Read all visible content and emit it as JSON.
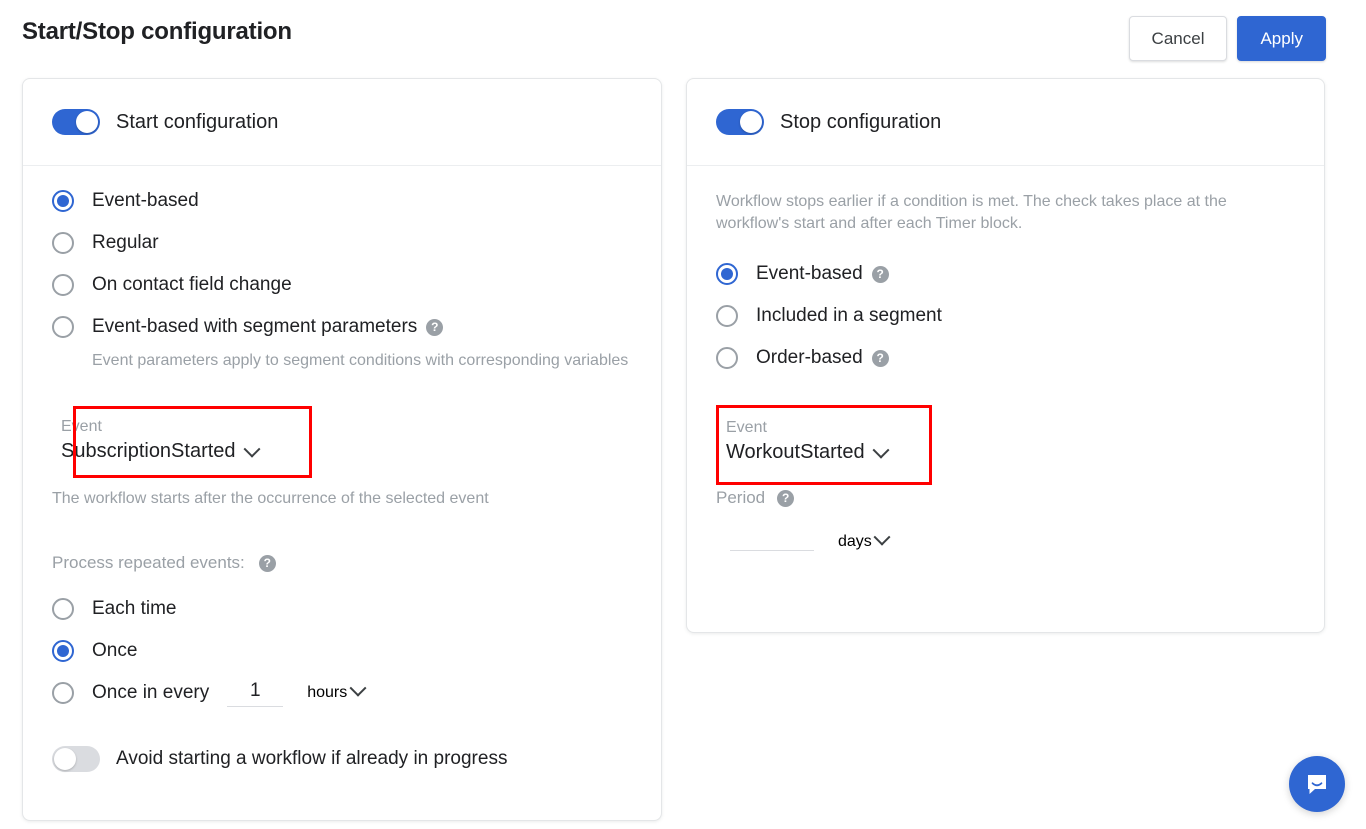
{
  "header": {
    "title": "Start/Stop configuration",
    "cancel_label": "Cancel",
    "apply_label": "Apply"
  },
  "colors": {
    "accent": "#2f66d2",
    "highlight": "#ff0000",
    "muted_text": "#9aa0a6",
    "text": "#202124",
    "border": "#e4e6e8"
  },
  "start_card": {
    "toggle_label": "Start configuration",
    "toggle_state": "on",
    "trigger_options": [
      {
        "label": "Event-based",
        "checked": true,
        "has_help": false
      },
      {
        "label": "Regular",
        "checked": false,
        "has_help": false
      },
      {
        "label": "On contact field change",
        "checked": false,
        "has_help": false
      },
      {
        "label": "Event-based with segment parameters",
        "checked": false,
        "has_help": true
      }
    ],
    "segment_params_hint": "Event parameters apply to segment conditions with corresponding variables",
    "event_field": {
      "label": "Event",
      "value": "SubscriptionStarted",
      "highlighted": true
    },
    "event_hint": "The workflow starts after the occurrence of the selected event",
    "repeat_section_label": "Process repeated events:",
    "repeat_options": [
      {
        "label": "Each time",
        "checked": false
      },
      {
        "label": "Once",
        "checked": true
      },
      {
        "label": "Once in every",
        "checked": false
      }
    ],
    "interval_value": "1",
    "interval_unit": "hours",
    "avoid_toggle_label": "Avoid starting a workflow if already in progress",
    "avoid_toggle_state": "off"
  },
  "stop_card": {
    "toggle_label": "Stop configuration",
    "toggle_state": "on",
    "description": "Workflow stops earlier if a condition is met. The check takes place at the workflow's start and after each Timer block.",
    "stop_options": [
      {
        "label": "Event-based",
        "checked": true,
        "has_help": true
      },
      {
        "label": "Included in a segment",
        "checked": false,
        "has_help": false
      },
      {
        "label": "Order-based",
        "checked": false,
        "has_help": true
      }
    ],
    "event_field": {
      "label": "Event",
      "value": "WorkoutStarted",
      "highlighted": true
    },
    "period": {
      "label": "Period",
      "has_help": true,
      "value": "",
      "unit": "days"
    }
  },
  "help_glyph": "?",
  "intercom": {
    "name": "intercom-chat-launcher"
  }
}
